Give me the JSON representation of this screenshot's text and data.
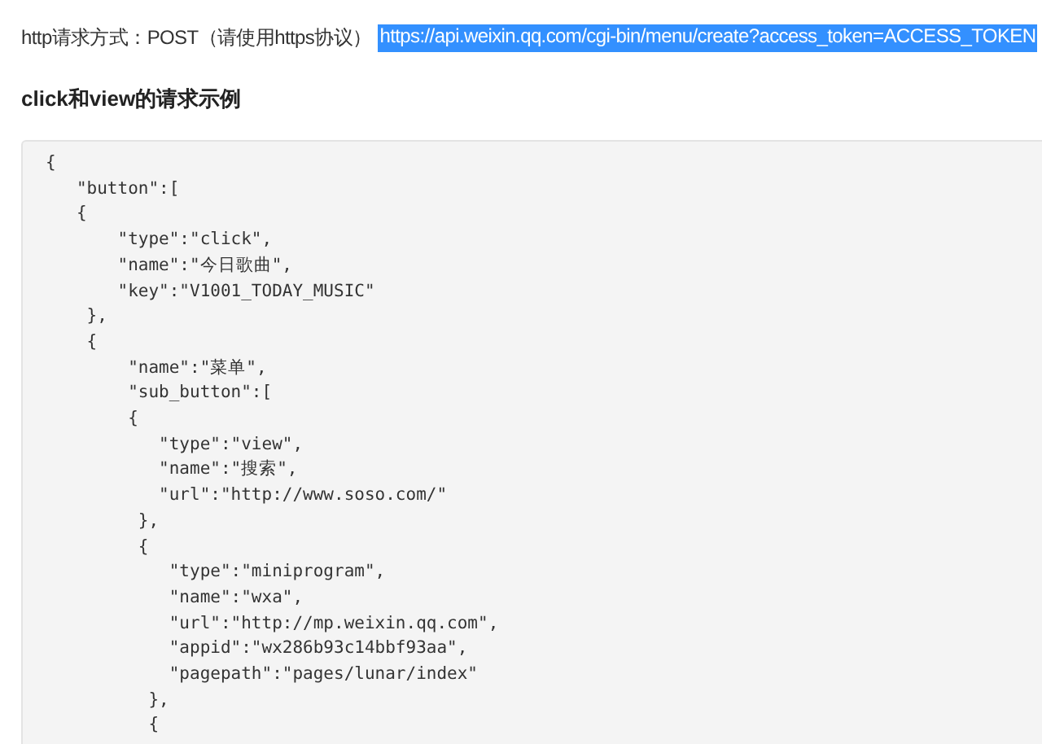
{
  "request_line": {
    "label": "http请求方式：POST（请使用https协议）",
    "url": "https://api.weixin.qq.com/cgi-bin/menu/create?access_token=ACCESS_TOKEN",
    "url_selected": true
  },
  "heading": "click和view的请求示例",
  "code_lines": [
    "{",
    "   \"button\":[",
    "   {",
    "       \"type\":\"click\",",
    "       \"name\":\"今日歌曲\",",
    "       \"key\":\"V1001_TODAY_MUSIC\"",
    "    },",
    "    {",
    "        \"name\":\"菜单\",",
    "        \"sub_button\":[",
    "        {",
    "           \"type\":\"view\",",
    "           \"name\":\"搜索\",",
    "           \"url\":\"http://www.soso.com/\"",
    "         },",
    "         {",
    "            \"type\":\"miniprogram\",",
    "            \"name\":\"wxa\",",
    "            \"url\":\"http://mp.weixin.qq.com\",",
    "            \"appid\":\"wx286b93c14bbf93aa\",",
    "            \"pagepath\":\"pages/lunar/index\"",
    "          },",
    "          {"
  ]
}
